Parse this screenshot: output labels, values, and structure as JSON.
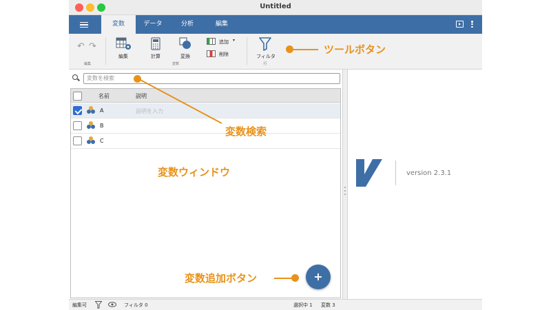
{
  "window": {
    "title": "Untitled"
  },
  "menubar": {
    "tabs": [
      {
        "label": "変数",
        "active": true
      },
      {
        "label": "データ",
        "active": false
      },
      {
        "label": "分析",
        "active": false
      },
      {
        "label": "編集",
        "active": false
      }
    ]
  },
  "ribbon": {
    "edit_group": "編集",
    "edit_label": "編集",
    "compute_label": "計算",
    "transform_label": "変換",
    "add_label": "追加",
    "delete_label": "削除",
    "variables_group": "変数",
    "filter_label": "フィルタ",
    "rows_group": "行"
  },
  "search": {
    "placeholder": "変数を検索"
  },
  "table": {
    "columns": {
      "name": "名前",
      "description": "説明"
    },
    "rows": [
      {
        "name": "A",
        "description": "説明を入力",
        "checked": true,
        "selected": true
      },
      {
        "name": "B",
        "description": "",
        "checked": false,
        "selected": false
      },
      {
        "name": "C",
        "description": "",
        "checked": false,
        "selected": false
      }
    ]
  },
  "fab": {
    "label": "+"
  },
  "statusbar": {
    "mode": "編集可",
    "filter": "フィルタ 0",
    "selected": "選択中 1",
    "variables": "変数 3"
  },
  "about": {
    "version": "version 2.3.1"
  },
  "callouts": {
    "toolbar": "ツールボタン",
    "search": "変数検索",
    "window": "変数ウィンドウ",
    "add": "変数追加ボタン"
  },
  "colors": {
    "accent": "#3e6ea6",
    "callout": "#e8921a",
    "checkbox": "#2f6dd0"
  },
  "icons": [
    "undo-icon",
    "redo-icon",
    "edit-variables-icon",
    "calculator-icon",
    "transform-icon",
    "add-icon",
    "delete-icon",
    "filter-icon",
    "search-icon",
    "variable-icon",
    "eye-icon",
    "menu-icon",
    "kebab-icon"
  ]
}
